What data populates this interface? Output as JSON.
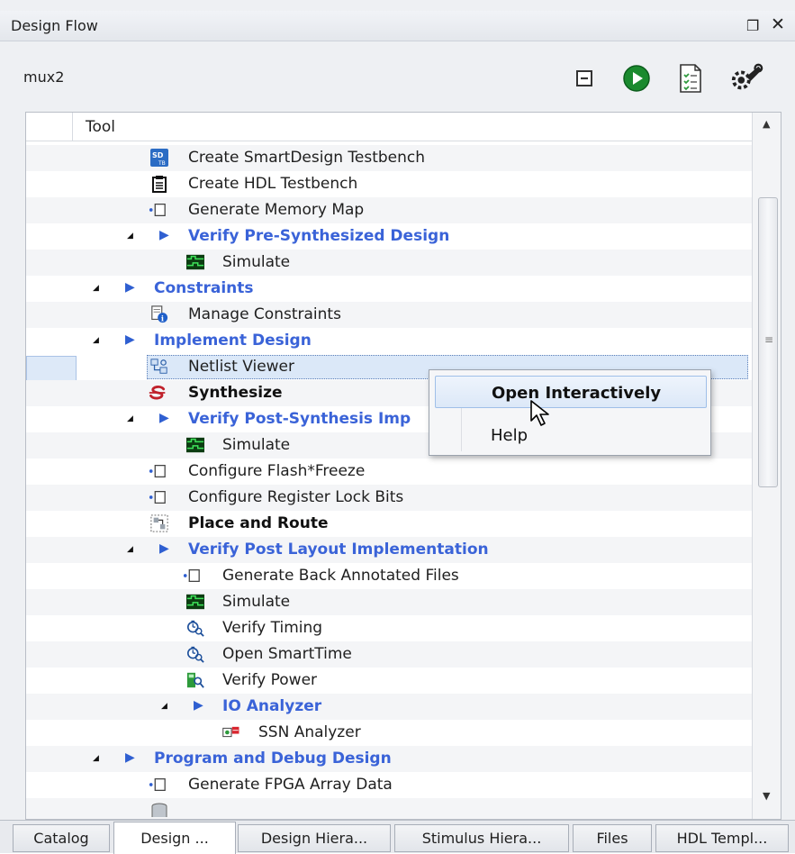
{
  "window": {
    "title": "Design Flow",
    "float_icon": "float-window-icon",
    "close_icon": "close-icon"
  },
  "toolbar": {
    "project": "mux2",
    "buttons": [
      "collapse-all-icon",
      "run-icon",
      "report-icon",
      "options-wrench-icon"
    ]
  },
  "tree": {
    "header": "Tool",
    "rows": [
      {
        "label": "Create SmartDesign Testbench",
        "icon": "smartdesign-tb-icon",
        "kind": "item"
      },
      {
        "label": "Create HDL Testbench",
        "icon": "clipboard-icon",
        "kind": "item"
      },
      {
        "label": "Generate Memory Map",
        "icon": "generate-doc-icon",
        "kind": "item"
      },
      {
        "label": "Verify Pre-Synthesized Design",
        "icon": "",
        "kind": "group"
      },
      {
        "label": "Simulate",
        "icon": "waveform-icon",
        "kind": "item"
      },
      {
        "label": "Constraints",
        "icon": "",
        "kind": "group"
      },
      {
        "label": "Manage Constraints",
        "icon": "manage-constraints-icon",
        "kind": "item"
      },
      {
        "label": "Implement Design",
        "icon": "",
        "kind": "group"
      },
      {
        "label": "Netlist Viewer",
        "icon": "netlist-icon",
        "kind": "item",
        "selected": true
      },
      {
        "label": "Synthesize",
        "icon": "synthesize-icon",
        "kind": "bold"
      },
      {
        "label": "Verify Post-Synthesis Imp",
        "icon": "",
        "kind": "group"
      },
      {
        "label": "Simulate",
        "icon": "waveform-icon",
        "kind": "item"
      },
      {
        "label": "Configure Flash*Freeze",
        "icon": "generate-doc-icon",
        "kind": "item"
      },
      {
        "label": "Configure Register Lock Bits",
        "icon": "generate-doc-icon",
        "kind": "item"
      },
      {
        "label": "Place and Route",
        "icon": "place-route-icon",
        "kind": "bold"
      },
      {
        "label": "Verify Post Layout Implementation",
        "icon": "",
        "kind": "group"
      },
      {
        "label": "Generate Back Annotated Files",
        "icon": "generate-doc-icon",
        "kind": "item"
      },
      {
        "label": "Simulate",
        "icon": "waveform-icon",
        "kind": "item"
      },
      {
        "label": "Verify Timing",
        "icon": "timing-icon",
        "kind": "item"
      },
      {
        "label": "Open SmartTime",
        "icon": "timing-icon",
        "kind": "item"
      },
      {
        "label": "Verify Power",
        "icon": "power-icon",
        "kind": "item"
      },
      {
        "label": "IO Analyzer",
        "icon": "",
        "kind": "group"
      },
      {
        "label": "SSN Analyzer",
        "icon": "ssn-icon",
        "kind": "item"
      },
      {
        "label": "Program and Debug Design",
        "icon": "",
        "kind": "group"
      },
      {
        "label": "Generate FPGA Array Data",
        "icon": "generate-doc-icon",
        "kind": "item"
      }
    ]
  },
  "context_menu": {
    "items": [
      "Open Interactively",
      "Help"
    ],
    "highlighted": "Open Interactively"
  },
  "tabs": [
    "Catalog",
    "Design ...",
    "Design Hiera...",
    "Stimulus Hiera...",
    "Files",
    "HDL Templ..."
  ],
  "active_tab": "Design ...",
  "colors": {
    "group_text": "#3a63d8",
    "selection": "#dbe8f8",
    "menu_highlight": "#dce8f8"
  }
}
